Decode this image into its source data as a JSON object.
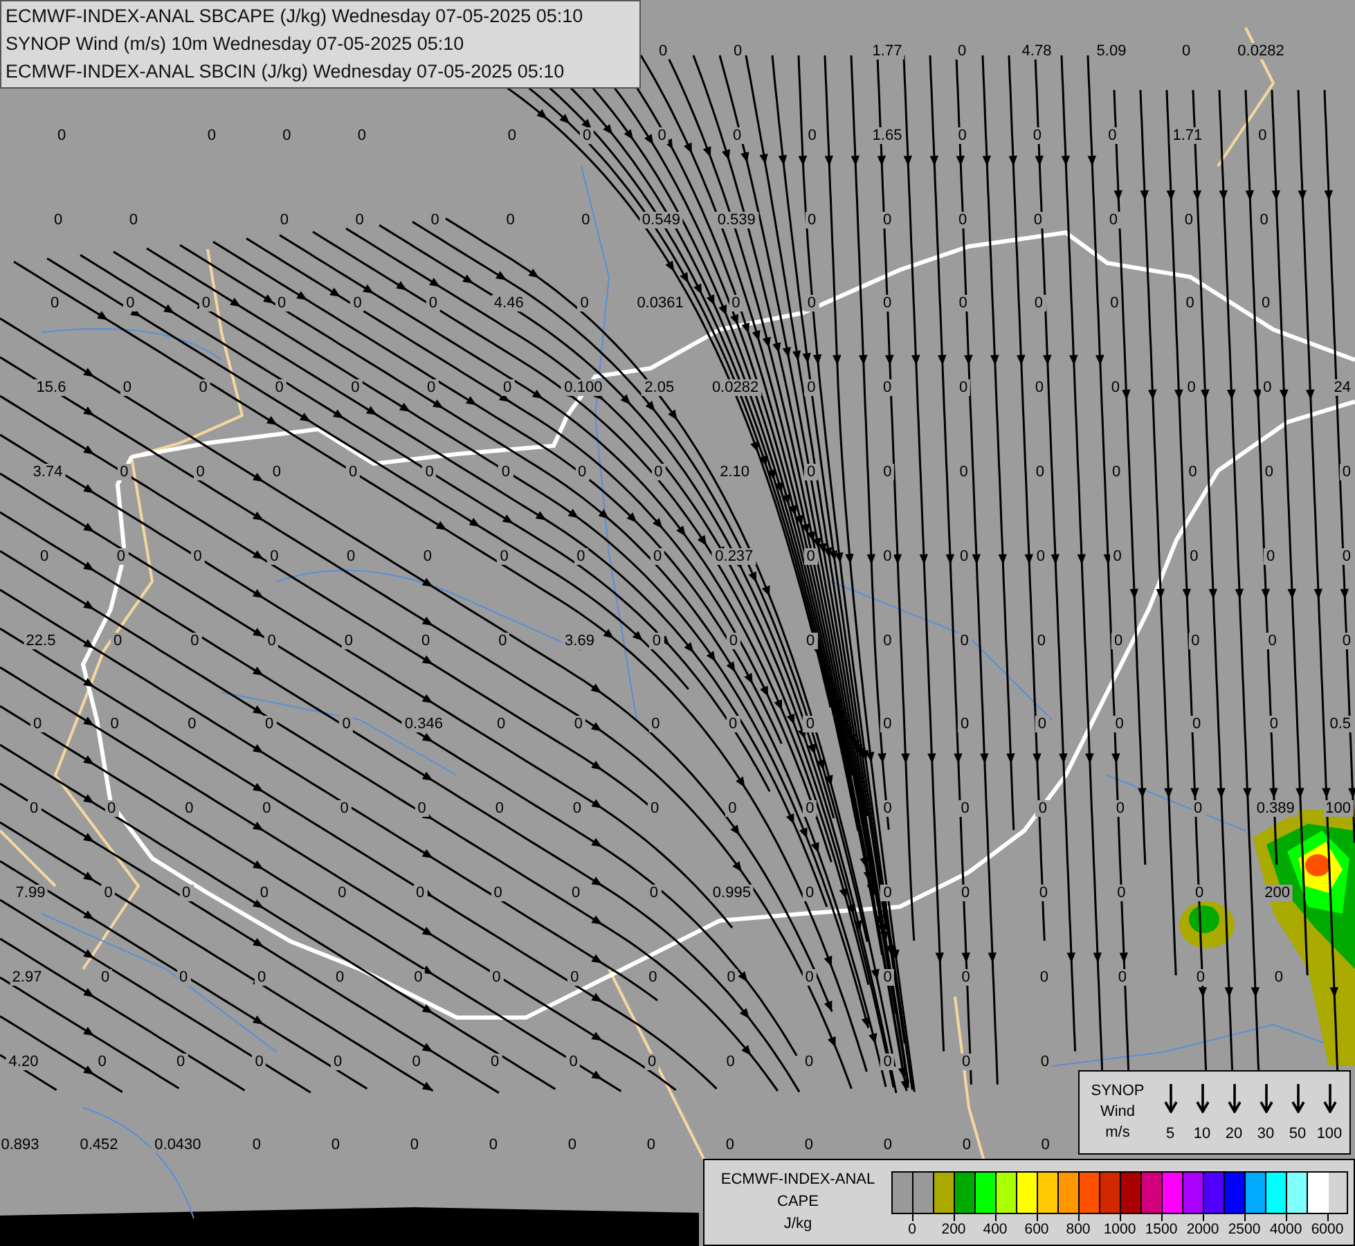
{
  "titles": [
    "ECMWF-INDEX-ANAL SBCAPE (J/kg) Wednesday 07-05-2025 05:10",
    "SYNOP Wind (m/s) 10m Wednesday 07-05-2025 05:10",
    "ECMWF-INDEX-ANAL SBCIN (J/kg) Wednesday 07-05-2025 05:10"
  ],
  "map": {
    "rows": [
      [
        null,
        null,
        null,
        null,
        null,
        null,
        null,
        null,
        "0",
        "0",
        null,
        "1.77",
        "0",
        "4.78",
        "5.09",
        "0",
        "0.0282",
        null
      ],
      [
        "0",
        null,
        "0",
        "0",
        "0",
        null,
        "0",
        "0",
        "0",
        "0",
        "0",
        "1.65",
        "0",
        "0",
        "0",
        "1.71",
        "0",
        null
      ],
      [
        "0",
        "0",
        null,
        "0",
        "0",
        "0",
        "0",
        "0",
        "0.549",
        "0.539",
        "0",
        "0",
        "0",
        "0",
        "0",
        "0",
        "0",
        null
      ],
      [
        "0",
        "0",
        "0",
        "0",
        "0",
        "0",
        "4.46",
        "0",
        "0.0361",
        "0",
        "0",
        "0",
        "0",
        "0",
        "0",
        "0",
        "0",
        null
      ],
      [
        "15.6",
        "0",
        "0",
        "0",
        "0",
        "0",
        "0",
        "0.100",
        "2.05",
        "0.0282",
        "0",
        "0",
        "0",
        "0",
        "0",
        "0",
        "0",
        "24"
      ],
      [
        "3.74",
        "0",
        "0",
        "0",
        "0",
        "0",
        "0",
        "0",
        "0",
        "2.10",
        "0",
        "0",
        "0",
        "0",
        "0",
        "0",
        "0",
        "0"
      ],
      [
        "0",
        "0",
        "0",
        "0",
        "0",
        "0",
        "0",
        "0",
        "0",
        "0.237",
        "0",
        "0",
        "0",
        "0",
        "0",
        "0",
        "0",
        "0"
      ],
      [
        "22.5",
        "0",
        "0",
        "0",
        "0",
        "0",
        "0",
        "3.69",
        "0",
        "0",
        "0",
        "0",
        "0",
        "0",
        "0",
        "0",
        "0",
        "0"
      ],
      [
        "0",
        "0",
        "0",
        "0",
        "0",
        "0.346",
        "0",
        "0",
        "0",
        "0",
        "0",
        "0",
        "0",
        "0",
        "0",
        "0",
        "0",
        "0.5"
      ],
      [
        "0",
        "0",
        "0",
        "0",
        "0",
        "0",
        "0",
        "0",
        "0",
        "0",
        "0",
        "0",
        "0",
        "0",
        "0",
        "0",
        "0.389",
        "100"
      ],
      [
        "7.99",
        "0",
        "0",
        "0",
        "0",
        "0",
        "0",
        "0",
        "0",
        "0.995",
        "0",
        "0",
        "0",
        "0",
        "0",
        "0",
        "200",
        null
      ],
      [
        "2.97",
        "0",
        "0",
        "0",
        "0",
        "0",
        "0",
        "0",
        "0",
        "0",
        "0",
        "0",
        "0",
        "0",
        "0",
        "0",
        "0",
        null
      ],
      [
        "4.20",
        "0",
        "0",
        "0",
        "0",
        "0",
        "0",
        "0",
        "0",
        "0",
        "0",
        "0",
        "0",
        "0",
        null,
        null,
        null,
        null
      ],
      [
        "0.893",
        "0.452",
        "0.0430",
        "0",
        "0",
        "0",
        "0",
        "0",
        "0",
        "0",
        "0",
        "0",
        "0",
        "0",
        null,
        null,
        null,
        null
      ]
    ]
  },
  "synop_legend": {
    "title": [
      "SYNOP",
      "Wind",
      "m/s"
    ],
    "speeds": [
      "5",
      "10",
      "20",
      "30",
      "50",
      "100"
    ]
  },
  "cape_legend": {
    "title": [
      "ECMWF-INDEX-ANAL",
      "CAPE",
      "J/kg"
    ],
    "swatches": [
      {
        "color": "#999999"
      },
      {
        "color": "#999999"
      },
      {
        "color": "#aaaa00"
      },
      {
        "color": "#00aa00"
      },
      {
        "color": "#00ff00"
      },
      {
        "color": "#aaff00"
      },
      {
        "color": "#ffff00"
      },
      {
        "color": "#ffc800"
      },
      {
        "color": "#ff9600"
      },
      {
        "color": "#ff5000"
      },
      {
        "color": "#d22800"
      },
      {
        "color": "#aa0000"
      },
      {
        "color": "#d2007d"
      },
      {
        "color": "#ff00ff"
      },
      {
        "color": "#aa00ff"
      },
      {
        "color": "#5000ff"
      },
      {
        "color": "#0000ff"
      },
      {
        "color": "#00aaff"
      },
      {
        "color": "#00ffff"
      },
      {
        "color": "#80ffff"
      },
      {
        "color": "#ffffff"
      }
    ],
    "ticks": [
      "0",
      "200",
      "400",
      "600",
      "800",
      "1000",
      "1500",
      "2000",
      "2500",
      "4000",
      "6000"
    ]
  }
}
